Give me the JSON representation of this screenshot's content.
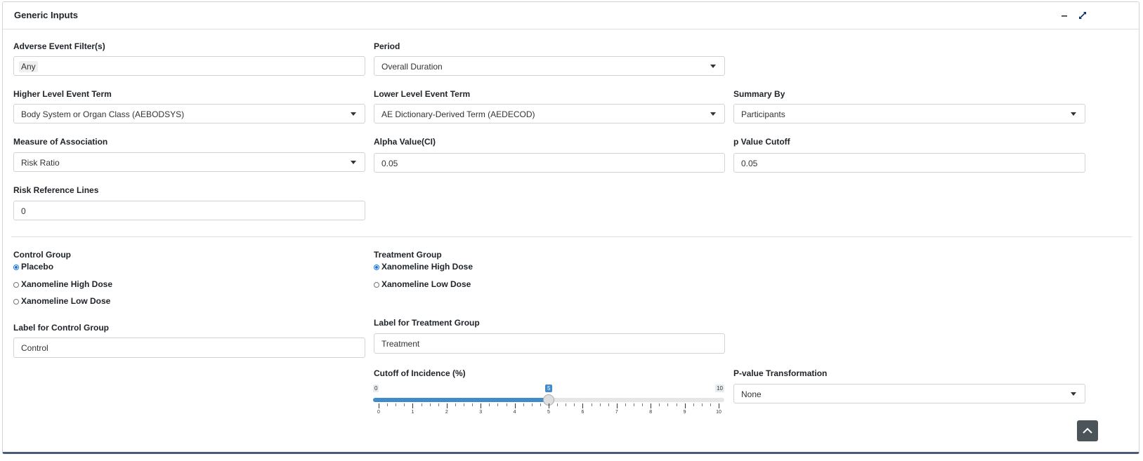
{
  "card": {
    "title": "Generic Inputs",
    "minimize_icon": "minus-icon",
    "expand_icon": "expand-icon"
  },
  "fields": {
    "ae_filter": {
      "label": "Adverse Event Filter(s)",
      "value": "Any"
    },
    "period": {
      "label": "Period",
      "value": "Overall Duration"
    },
    "hlt": {
      "label": "Higher Level Event Term",
      "value": "Body System or Organ Class (AEBODSYS)"
    },
    "llt": {
      "label": "Lower Level Event Term",
      "value": "AE Dictionary-Derived Term (AEDECOD)"
    },
    "summary_by": {
      "label": "Summary By",
      "value": "Participants"
    },
    "measure": {
      "label": "Measure of Association",
      "value": "Risk Ratio"
    },
    "alpha": {
      "label": "Alpha Value(CI)",
      "value": "0.05"
    },
    "p_cutoff": {
      "label": "p Value Cutoff",
      "value": "0.05"
    },
    "risk_ref": {
      "label": "Risk Reference Lines",
      "value": "0"
    },
    "ctrl_label": {
      "label": "Label for Control Group",
      "value": "Control"
    },
    "trt_label": {
      "label": "Label for Treatment Group",
      "value": "Treatment"
    },
    "pval_transform": {
      "label": "P-value Transformation",
      "value": "None"
    }
  },
  "control_group": {
    "label": "Control Group",
    "options": [
      "Placebo",
      "Xanomeline High Dose",
      "Xanomeline Low Dose"
    ],
    "selected": "Placebo"
  },
  "treatment_group": {
    "label": "Treatment Group",
    "options": [
      "Xanomeline High Dose",
      "Xanomeline Low Dose"
    ],
    "selected": "Xanomeline High Dose"
  },
  "cutoff_slider": {
    "label": "Cutoff of Incidence (%)",
    "min": 0,
    "max": 10,
    "value": 5,
    "min_label": "0",
    "max_label": "10",
    "value_label": "5",
    "tick_labels": [
      "0",
      "1",
      "2",
      "3",
      "4",
      "5",
      "6",
      "7",
      "8",
      "9",
      "10"
    ]
  },
  "colors": {
    "accent": "#428bca",
    "radio_selected": "#1a73e8",
    "card_border_bottom": "#4a5a78",
    "scroll_button": "#4a5459"
  },
  "scroll_top_icon": "chevron-up-icon"
}
